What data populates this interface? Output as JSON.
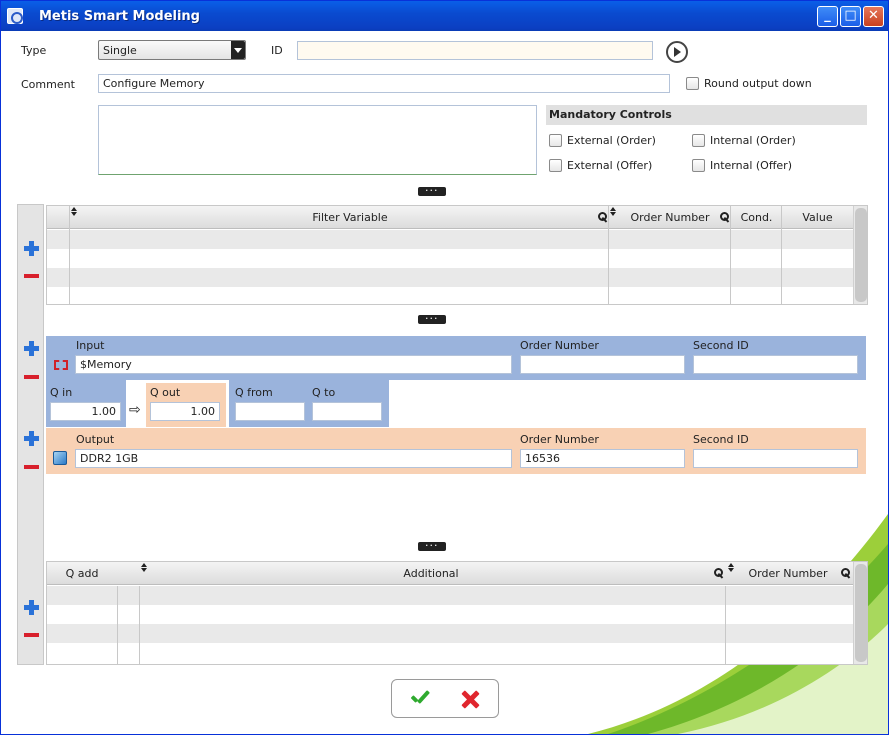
{
  "window": {
    "title": "Metis Smart Modeling"
  },
  "header": {
    "type_label": "Type",
    "type_value": "Single",
    "id_label": "ID",
    "id_value": "",
    "comment_label": "Comment",
    "comment_value": "Configure Memory",
    "round_output_label": "Round output down"
  },
  "mandatory": {
    "title": "Mandatory Controls",
    "items": [
      "External (Order)",
      "Internal (Order)",
      "External (Offer)",
      "Internal (Offer)"
    ]
  },
  "filter_grid": {
    "columns": [
      "Filter Variable",
      "Order Number",
      "Cond.",
      "Value"
    ]
  },
  "input_panel": {
    "label": "Input",
    "value": "$Memory",
    "order_label": "Order Number",
    "order_value": "",
    "second_label": "Second ID",
    "second_value": ""
  },
  "quantities": {
    "q_in_label": "Q in",
    "q_in_value": "1.00",
    "q_out_label": "Q out",
    "q_out_value": "1.00",
    "q_from_label": "Q from",
    "q_from_value": "",
    "q_to_label": "Q to",
    "q_to_value": ""
  },
  "output_panel": {
    "label": "Output",
    "value": "DDR2 1GB",
    "order_label": "Order Number",
    "order_value": "16536",
    "second_label": "Second ID",
    "second_value": ""
  },
  "additional_grid": {
    "columns": [
      "Q add",
      "Additional",
      "Order Number"
    ]
  },
  "colors": {
    "input_panel": "#9ab3dc",
    "output_panel": "#f8d1b4",
    "titlebar": "#0a4bd0"
  }
}
